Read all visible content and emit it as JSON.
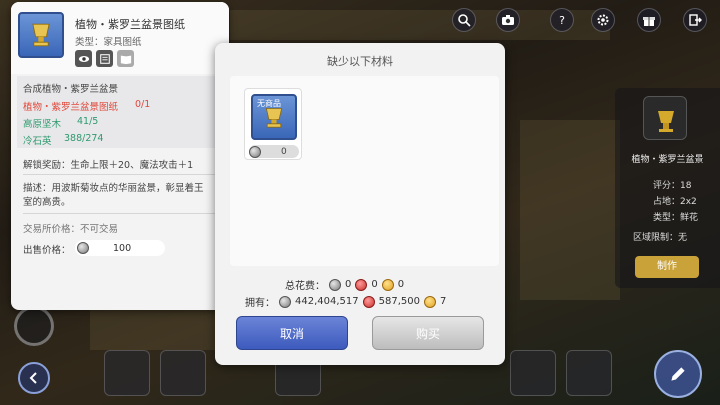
{
  "colors": {
    "accent_blue": "#4a66c8",
    "red_text": "#e0473a",
    "green_text": "#2e9a6e",
    "gold": "#c9a23a"
  },
  "top_bar": {
    "icons": [
      "search-icon",
      "camera-icon",
      "help-icon",
      "settings-icon",
      "gift-icon",
      "exit-icon"
    ]
  },
  "tooltip": {
    "title": "植物・紫罗兰盆景图纸",
    "type_label": "类型：家具图纸",
    "craft_title": "合成植物・紫罗兰盆景",
    "materials": [
      {
        "name": "植物・紫罗兰盆景图纸",
        "count": "0/1",
        "color": "red"
      },
      {
        "name": "高原坚木",
        "count": "41/5",
        "color": "green"
      },
      {
        "name": "冷石英",
        "count": "388/274",
        "color": "green"
      }
    ],
    "unlock_reward": "解锁奖励：生命上限＋20、魔法攻击＋1",
    "description": "描述：用波斯菊妆点的华丽盆景，彰显着王室的高贵。",
    "exchange_price": "交易所价格：不可交易",
    "sell_label": "出售价格：",
    "sell_value": "100"
  },
  "dialog": {
    "title": "缺少以下材料",
    "item": {
      "badge": "无商品",
      "count": "0"
    },
    "total_cost_label": "总花费：",
    "total_cost": {
      "zeny": "0",
      "ruby": "0",
      "cat_coin": "0"
    },
    "owned_label": "拥有：",
    "owned": {
      "zeny": "442,404,517",
      "ruby": "587,500",
      "cat_coin": "7"
    },
    "cancel_label": "取消",
    "buy_label": "购买"
  },
  "right_panel": {
    "name": "植物・紫罗兰盆景",
    "score": "评分：18",
    "area": "占地：2x2",
    "type": "类型：鲜花",
    "region_limit": "区域限制：无",
    "button_label": "制作"
  }
}
